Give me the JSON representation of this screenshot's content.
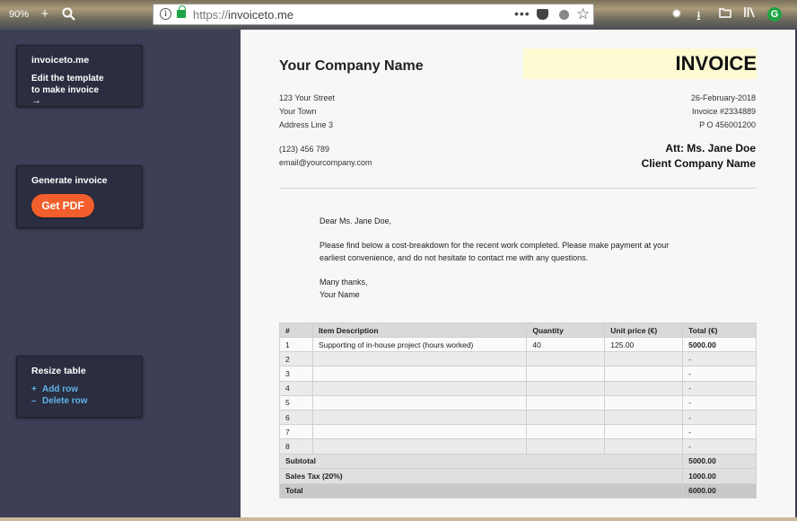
{
  "browser": {
    "zoom": "90%",
    "url_scheme": "https://",
    "url_host": "invoiceto.me",
    "extension_label": "G"
  },
  "sidebar": {
    "brand": "invoiceto.me",
    "edit_line1": "Edit the template",
    "edit_line2": "to make invoice",
    "edit_arrow": "→",
    "generate_title": "Generate invoice",
    "pdf_button": "Get PDF",
    "resize_title": "Resize table",
    "add_row": "Add row",
    "add_symbol": "+",
    "delete_row": "Delete row",
    "delete_symbol": "–"
  },
  "invoice": {
    "company_name": "Your Company Name",
    "title": "INVOICE",
    "address": [
      "123 Your Street",
      "Your Town",
      "Address Line 3"
    ],
    "phone": "(123) 456 789",
    "email": "email@yourcompany.com",
    "date": "26-February-2018",
    "invoice_no": "Invoice #2334889",
    "po": "P O 456001200",
    "att": "Att: Ms. Jane Doe",
    "client": "Client Company Name",
    "greeting": "Dear Ms. Jane Doe,",
    "body_line1": "Please find below a cost-breakdown for the recent work completed. Please make payment at your",
    "body_line2": "earliest convenience, and do not hesitate to contact me with any questions.",
    "signoff": "Many thanks,",
    "signature": "Your Name"
  },
  "table": {
    "headers": [
      "#",
      "Item Description",
      "Quantity",
      "Unit price (€)",
      "Total (€)"
    ],
    "rows": [
      [
        "1",
        "Supporting of in-house project (hours worked)",
        "40",
        "125.00",
        "5000.00"
      ],
      [
        "2",
        "",
        "",
        "",
        "-"
      ],
      [
        "3",
        "",
        "",
        "",
        "-"
      ],
      [
        "4",
        "",
        "",
        "",
        "-"
      ],
      [
        "5",
        "",
        "",
        "",
        "-"
      ],
      [
        "6",
        "",
        "",
        "",
        "-"
      ],
      [
        "7",
        "",
        "",
        "",
        "-"
      ],
      [
        "8",
        "",
        "",
        "",
        "-"
      ]
    ],
    "subtotal_label": "Subtotal",
    "subtotal_value": "5000.00",
    "tax_label": "Sales Tax (20%)",
    "tax_value": "1000.00",
    "total_label": "Total",
    "total_value": "6000.00"
  }
}
